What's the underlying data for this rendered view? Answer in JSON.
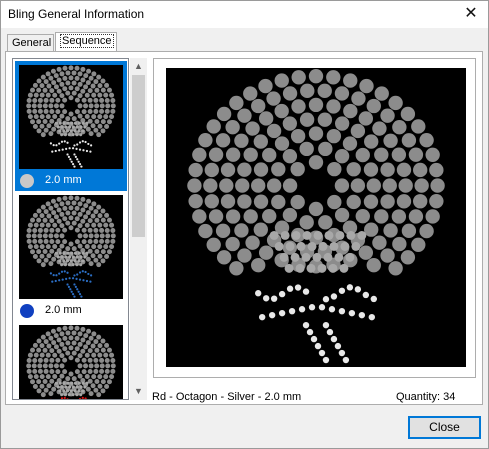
{
  "window": {
    "title": "Bling General Information",
    "close_glyph": "✕"
  },
  "tabs": [
    {
      "label": "General",
      "selected": false
    },
    {
      "label": "Sequence",
      "selected": true
    }
  ],
  "list": {
    "items": [
      {
        "label": "2.0 mm",
        "gem_icon": "silver-gem-icon",
        "gem_color": "#c8c8c8",
        "selected": true,
        "accent": "#dcdcdc"
      },
      {
        "label": "2.0 mm",
        "gem_icon": "blue-gem-icon",
        "gem_color": "#1040c0",
        "selected": false,
        "accent": "#2b6ec4"
      },
      {
        "label": "",
        "gem_icon": "red-gem-icon",
        "gem_color": "#e01010",
        "selected": false,
        "accent": "#e01010"
      }
    ],
    "scroll_up": "▲",
    "scroll_down": "▼"
  },
  "preview": {
    "info": "Rd - Octagon - Silver - 2.0 mm",
    "quantity": "Quantity: 34",
    "stone_color": "#8c8c8c",
    "highlight_color": "#e8e8e8"
  },
  "buttons": {
    "close": "Close"
  },
  "colors": {
    "accent": "#0078d7"
  }
}
